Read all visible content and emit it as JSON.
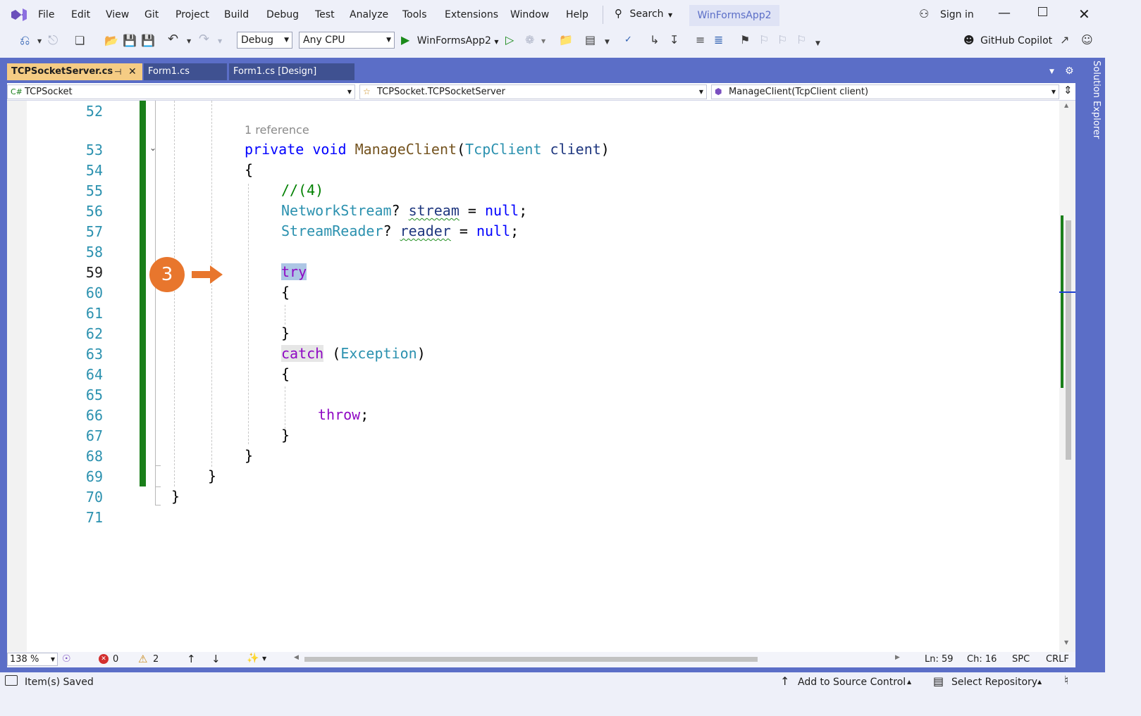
{
  "menu": [
    "File",
    "Edit",
    "View",
    "Git",
    "Project",
    "Build",
    "Debug",
    "Test",
    "Analyze",
    "Tools",
    "Extensions",
    "Window",
    "Help"
  ],
  "search_label": "Search",
  "solution_name": "WinFormsApp2",
  "sign_in": "Sign in",
  "toolbar": {
    "config": "Debug",
    "platform": "Any CPU",
    "start_target": "WinFormsApp2",
    "copilot": "GitHub Copilot"
  },
  "tabs": [
    {
      "label": "TCPSocketServer.cs",
      "active": true,
      "pinned": true
    },
    {
      "label": "Form1.cs",
      "active": false
    },
    {
      "label": "Form1.cs [Design]",
      "active": false
    }
  ],
  "side_panel": "Solution Explorer",
  "navbar": {
    "project": "TCPSocket",
    "type": "TCPSocket.TCPSocketServer",
    "member": "ManageClient(TcpClient client)"
  },
  "editor": {
    "codelens": "1 reference",
    "callout_number": "3",
    "line_numbers": [
      "52",
      "53",
      "54",
      "55",
      "56",
      "57",
      "58",
      "59",
      "60",
      "61",
      "62",
      "63",
      "64",
      "65",
      "66",
      "67",
      "68",
      "69",
      "70",
      "71"
    ],
    "current_line": "59",
    "code": {
      "l53_private": "private",
      "l53_void": "void",
      "l53_name": "ManageClient",
      "l53_paren": "(",
      "l53_type": "TcpClient",
      "l53_param": "client",
      "l53_close": ")",
      "open_brace": "{",
      "close_brace": "}",
      "l55_comment": "//(4)",
      "l56_type": "NetworkStream",
      "l56_q": "?",
      "l56_var": "stream",
      "l56_eq": " = ",
      "null": "null",
      "semi": ";",
      "l57_type": "StreamReader",
      "l57_var": "reader",
      "l59_try": "try",
      "l63_catch": "catch",
      "l63_open": " (",
      "l63_type": "Exception",
      "l63_close": ")",
      "l66_throw": "throw"
    }
  },
  "editor_status": {
    "zoom": "138 %",
    "errors": "0",
    "warnings": "2",
    "line": "Ln: 59",
    "col": "Ch: 16",
    "whitespace": "SPC",
    "line_ending": "CRLF"
  },
  "statusbar": {
    "message": "Item(s) Saved",
    "source_control": "Add to Source Control",
    "repository": "Select Repository"
  },
  "colors": {
    "accent": "#5b6ec7",
    "tab_active": "#f5cc84",
    "tab_inactive": "#3f5191",
    "changed_margin": "#1a7f1a",
    "callout": "#e8762d"
  }
}
